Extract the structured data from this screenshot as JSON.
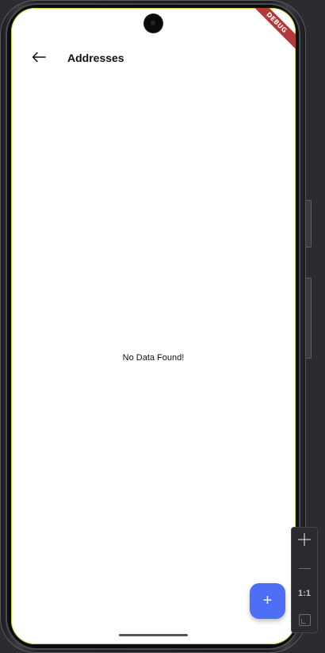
{
  "app_bar": {
    "title": "Addresses",
    "back_icon": "arrow-left-icon"
  },
  "body": {
    "empty_message": "No Data Found!"
  },
  "fab": {
    "label": "+",
    "icon": "plus-icon",
    "color": "#4d6ef5"
  },
  "debug_banner": {
    "label": "DEBUG",
    "color": "#b23a3a"
  },
  "zoom_toolbar": {
    "zoom_in_icon": "plus-icon",
    "zoom_out_icon": "minus-icon",
    "reset_label": "1:1",
    "fit_icon": "fit-screen-icon"
  }
}
